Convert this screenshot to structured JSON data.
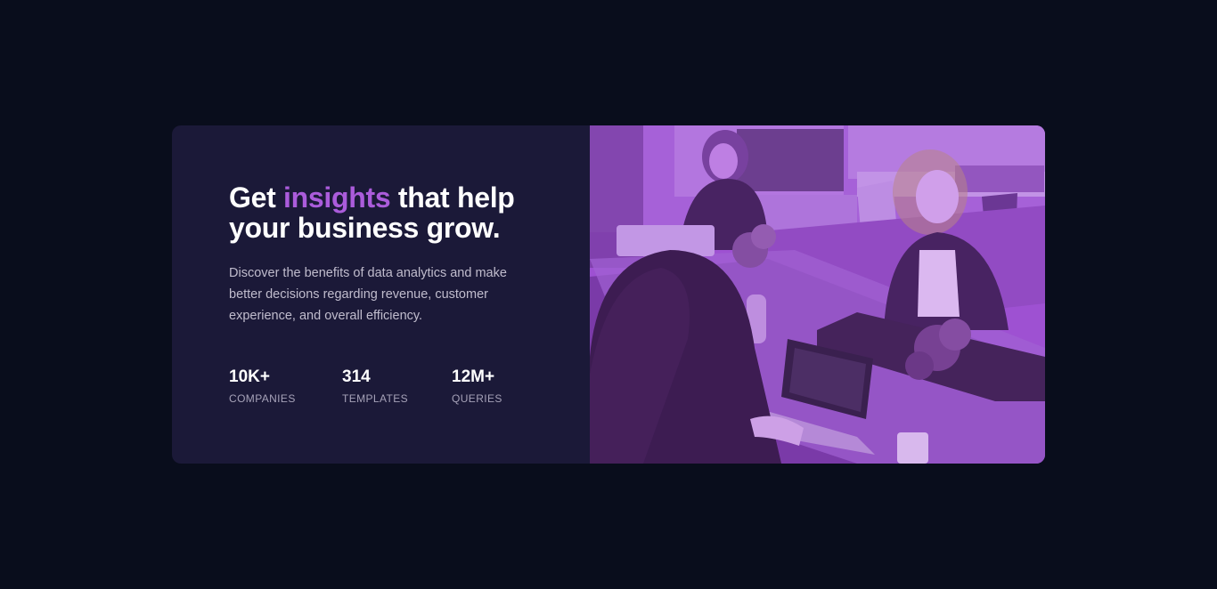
{
  "hero": {
    "title_before": "Get ",
    "title_accent": "insights",
    "title_after": " that help your business grow.",
    "description": "Discover the benefits of data analytics and make better decisions regarding revenue, customer experience, and overall efficiency.",
    "accent_color": "#ab5cdb"
  },
  "stats": [
    {
      "value": "10K+",
      "label": "COMPANIES"
    },
    {
      "value": "314",
      "label": "TEMPLATES"
    },
    {
      "value": "12M+",
      "label": "QUERIES"
    }
  ],
  "image": {
    "subject": "people-working-at-table-photo",
    "tint_color": "#aa5cdb"
  }
}
